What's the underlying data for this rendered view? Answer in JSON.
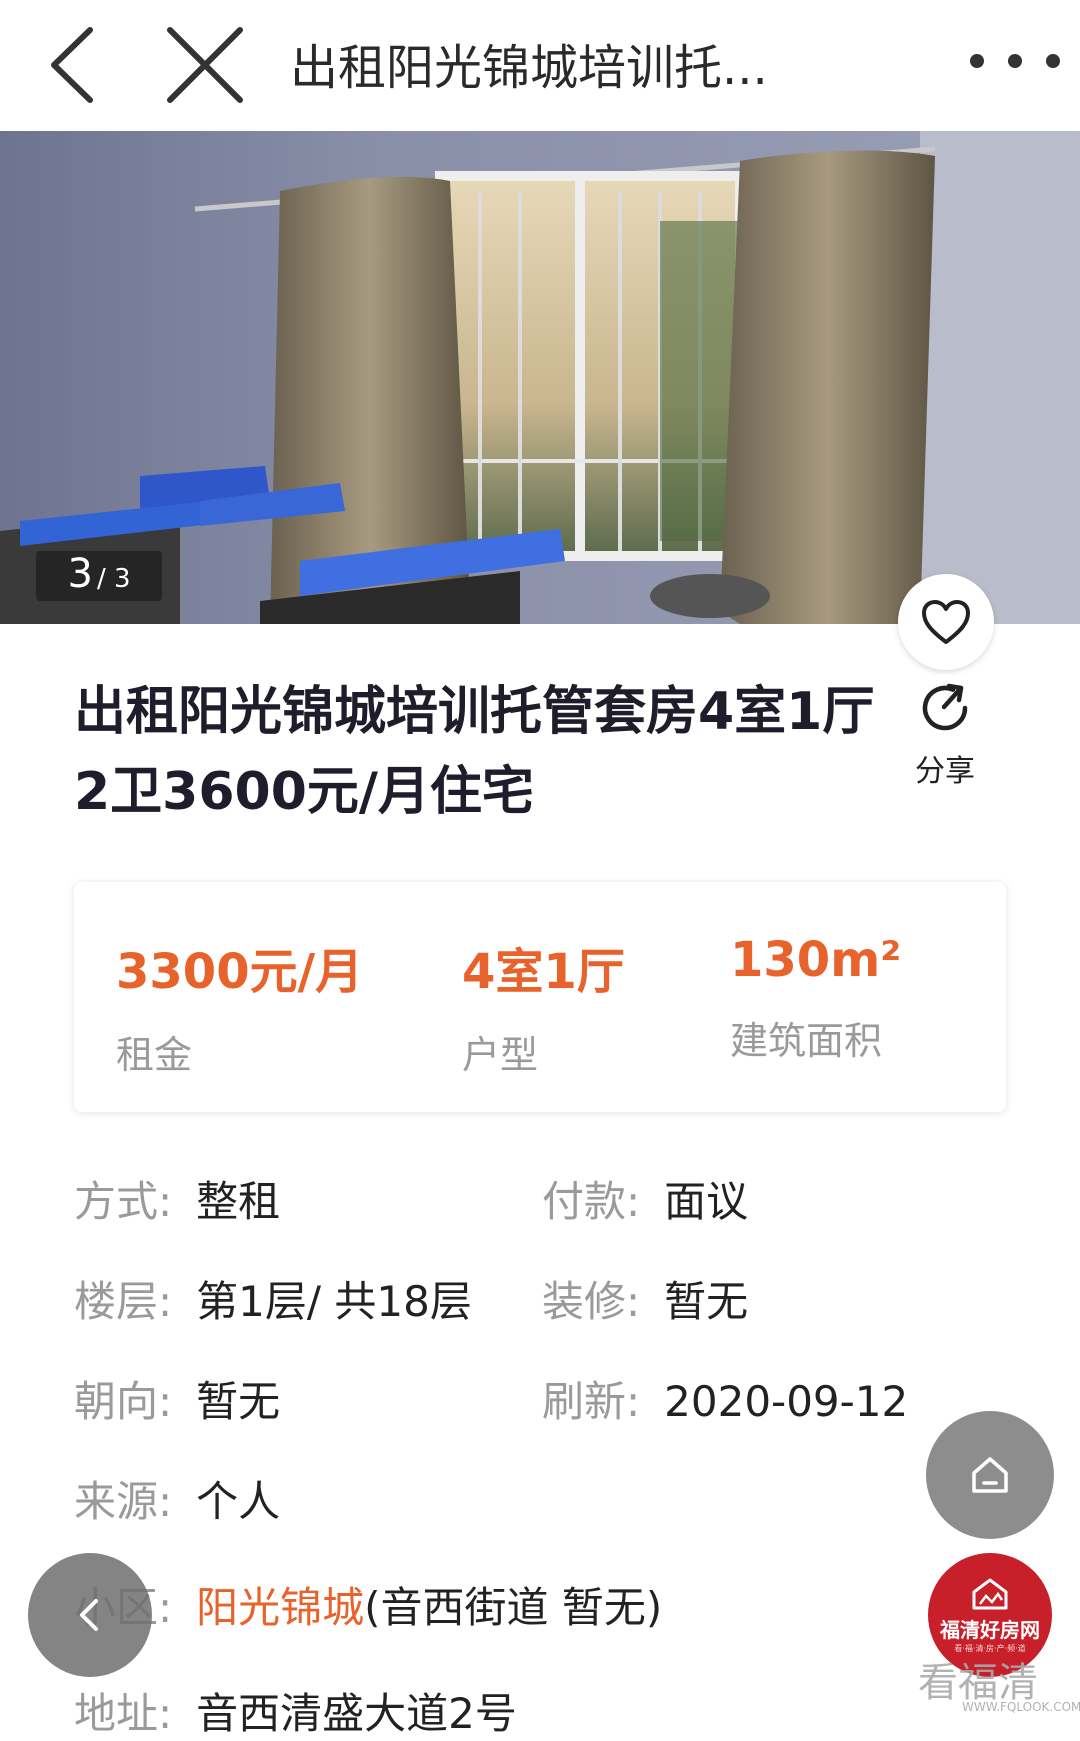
{
  "nav": {
    "title": "出租阳光锦城培训托..."
  },
  "gallery": {
    "current": "3",
    "total": "/ 3"
  },
  "listing": {
    "headline": "出租阳光锦城培训托管套房4室1厅2卫3600元/月住宅",
    "share_label": "分享"
  },
  "summary": {
    "rent_value": "3300元/月",
    "rent_label": "租金",
    "layout_value": "4室1厅",
    "layout_label": "户型",
    "area_value": "130m²",
    "area_label": "建筑面积"
  },
  "details": {
    "mode_key": "方式:",
    "mode_value": "整租",
    "payment_key": "付款:",
    "payment_value": "面议",
    "floor_key": "楼层:",
    "floor_value": "第1层/ 共18层",
    "decoration_key": "装修:",
    "decoration_value": "暂无",
    "orientation_key": "朝向:",
    "orientation_value": "暂无",
    "refresh_key": "刷新:",
    "refresh_value": "2020-09-12",
    "source_key": "来源:",
    "source_value": "个人",
    "community_key": "小区:",
    "community_link": "阳光锦城",
    "community_extra": "(音西街道 暂无)",
    "address_key": "地址:",
    "address_value": "音西清盛大道2号"
  },
  "branding": {
    "logo_text": "福清好房网",
    "logo_sub": "看·福·清·房·产·频·道",
    "watermark": "看福清",
    "watermark_url": "WWW.FQLOOK.COM"
  },
  "colors": {
    "accent": "#e8622b",
    "label_gray": "#9a9a9a",
    "logo_red": "#c8202a"
  },
  "icons": [
    "back-arrow-icon",
    "close-icon",
    "more-dots-icon",
    "heart-icon",
    "share-icon",
    "home-icon",
    "chevron-left-icon"
  ]
}
